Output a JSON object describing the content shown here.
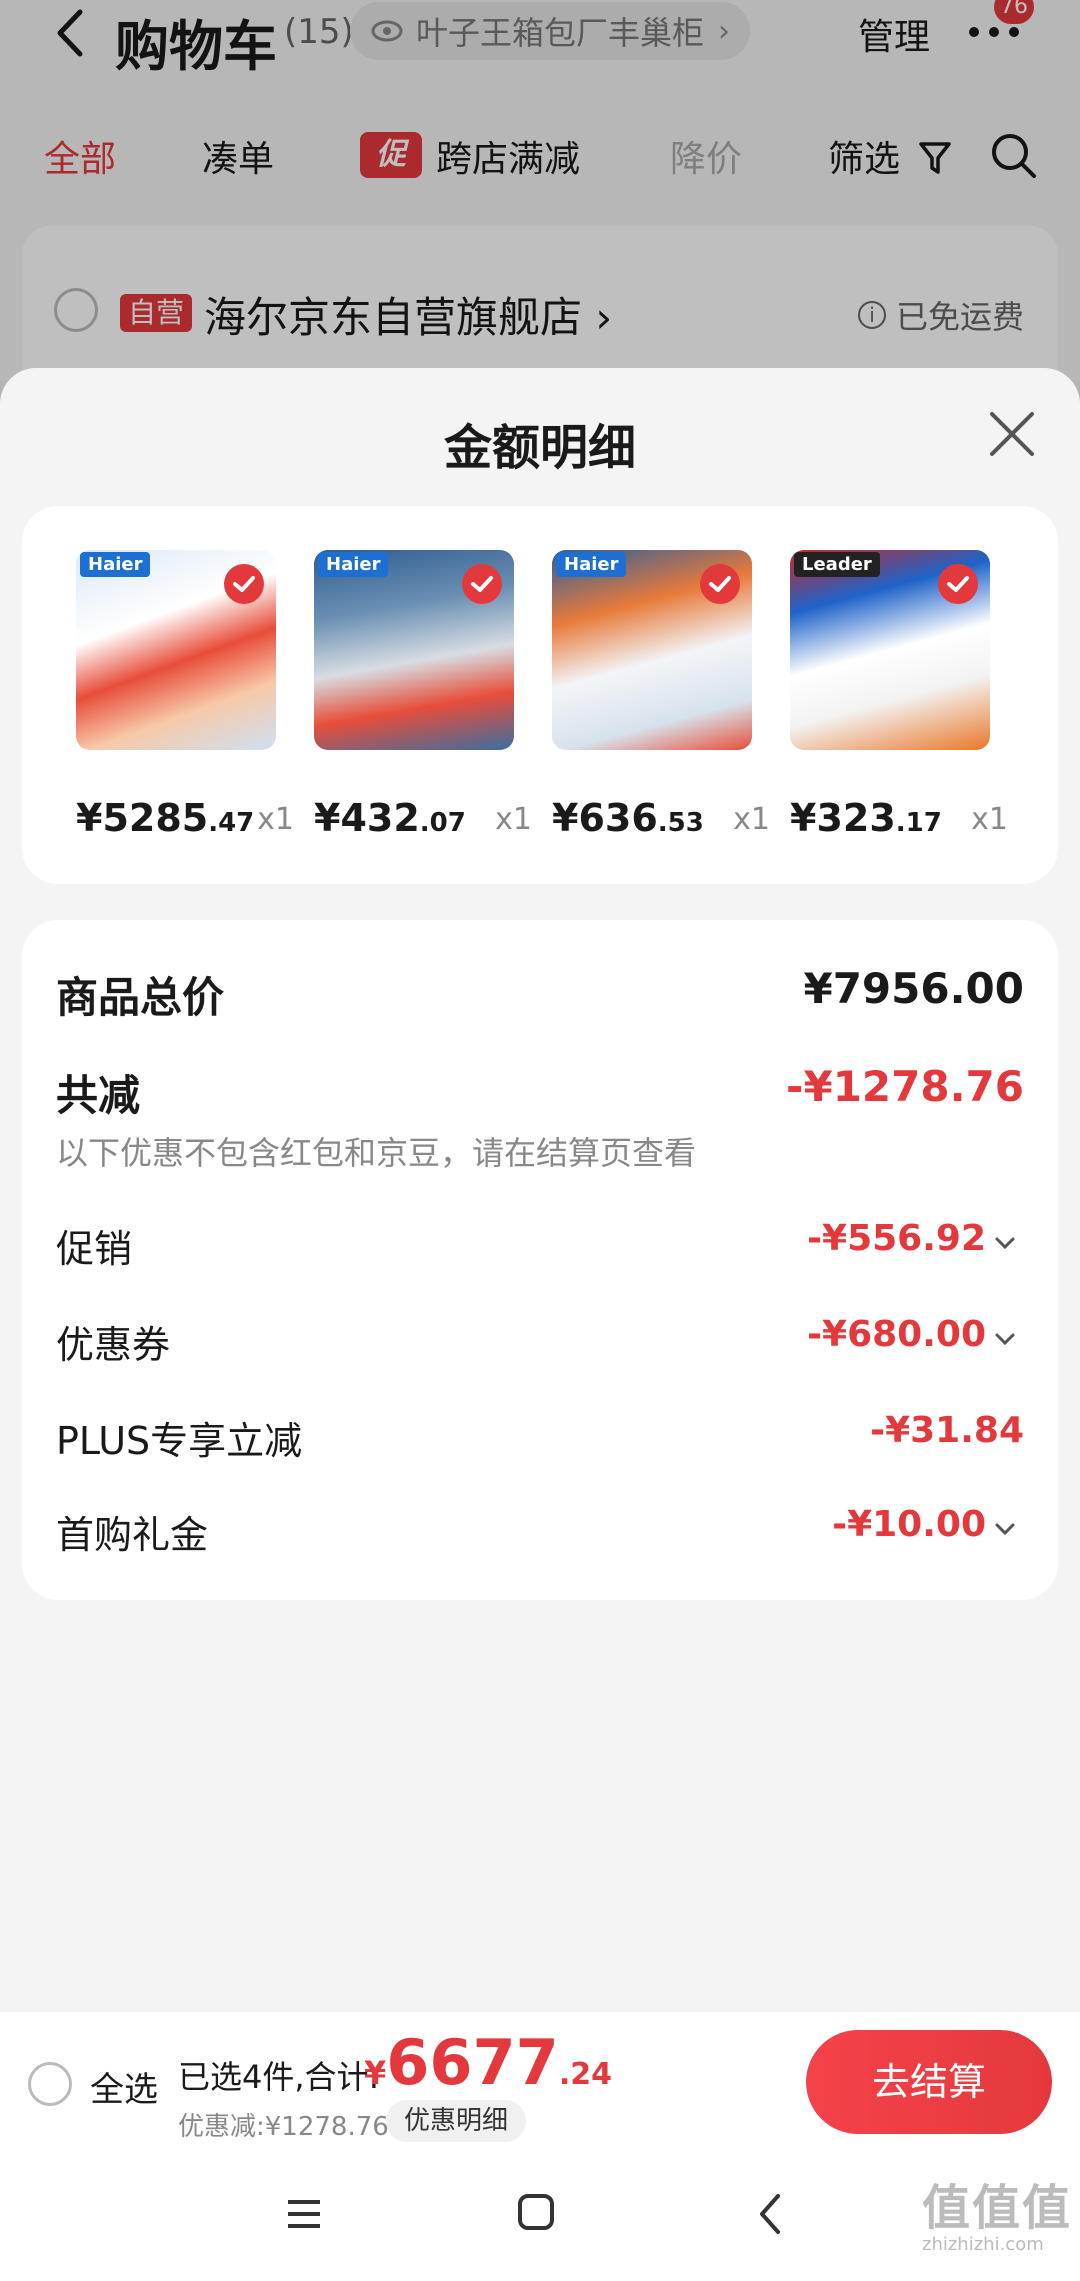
{
  "header": {
    "title": "购物车",
    "count": "(15)",
    "address": "叶子王箱包厂丰巢柜",
    "manage": "管理",
    "more_badge": "76"
  },
  "tabs": [
    {
      "label": "全部",
      "state": "active"
    },
    {
      "label": "凑单",
      "state": "normal"
    },
    {
      "label": "跨店满减",
      "state": "normal",
      "tag": "促"
    },
    {
      "label": "降价",
      "state": "disabled"
    },
    {
      "label": "筛选",
      "state": "normal"
    }
  ],
  "store": {
    "tag": "自营",
    "name": "海尔京东自营旗舰店",
    "shipping": "已免运费"
  },
  "sheet": {
    "title": "金额明细",
    "items": [
      {
        "brand": "Haier",
        "price_int": "¥5285",
        "price_dec": ".47",
        "qty": "x1"
      },
      {
        "brand": "Haier",
        "price_int": "¥432",
        "price_dec": ".07",
        "qty": "x1"
      },
      {
        "brand": "Haier",
        "price_int": "¥636",
        "price_dec": ".53",
        "qty": "x1"
      },
      {
        "brand": "Leader",
        "price_int": "¥323",
        "price_dec": ".17",
        "qty": "x1"
      }
    ],
    "total_label": "商品总价",
    "total_value": "¥7956.00",
    "reduce_label": "共减",
    "reduce_value": "-¥1278.76",
    "note": "以下优惠不包含红包和京豆，请在结算页查看",
    "discounts": [
      {
        "label": "促销",
        "value": "-¥556.92",
        "expandable": true
      },
      {
        "label": "优惠券",
        "value": "-¥680.00",
        "expandable": true
      },
      {
        "label": "PLUS专享立减",
        "value": "-¥31.84",
        "expandable": false
      },
      {
        "label": "首购礼金",
        "value": "-¥10.00",
        "expandable": true
      }
    ]
  },
  "bottom": {
    "select_all": "全选",
    "selected": "已选4件,合计:",
    "total_yen": "¥",
    "total_int": "6677",
    "total_dec": ".24",
    "discount": "优惠减:¥1278.76",
    "detail_chip": "优惠明细",
    "checkout": "去结算"
  },
  "watermark": {
    "mark": "值值值",
    "url": "zhizhizhi.com"
  },
  "colors": {
    "accent": "#e4393c",
    "bg": "#f4f4f4"
  }
}
